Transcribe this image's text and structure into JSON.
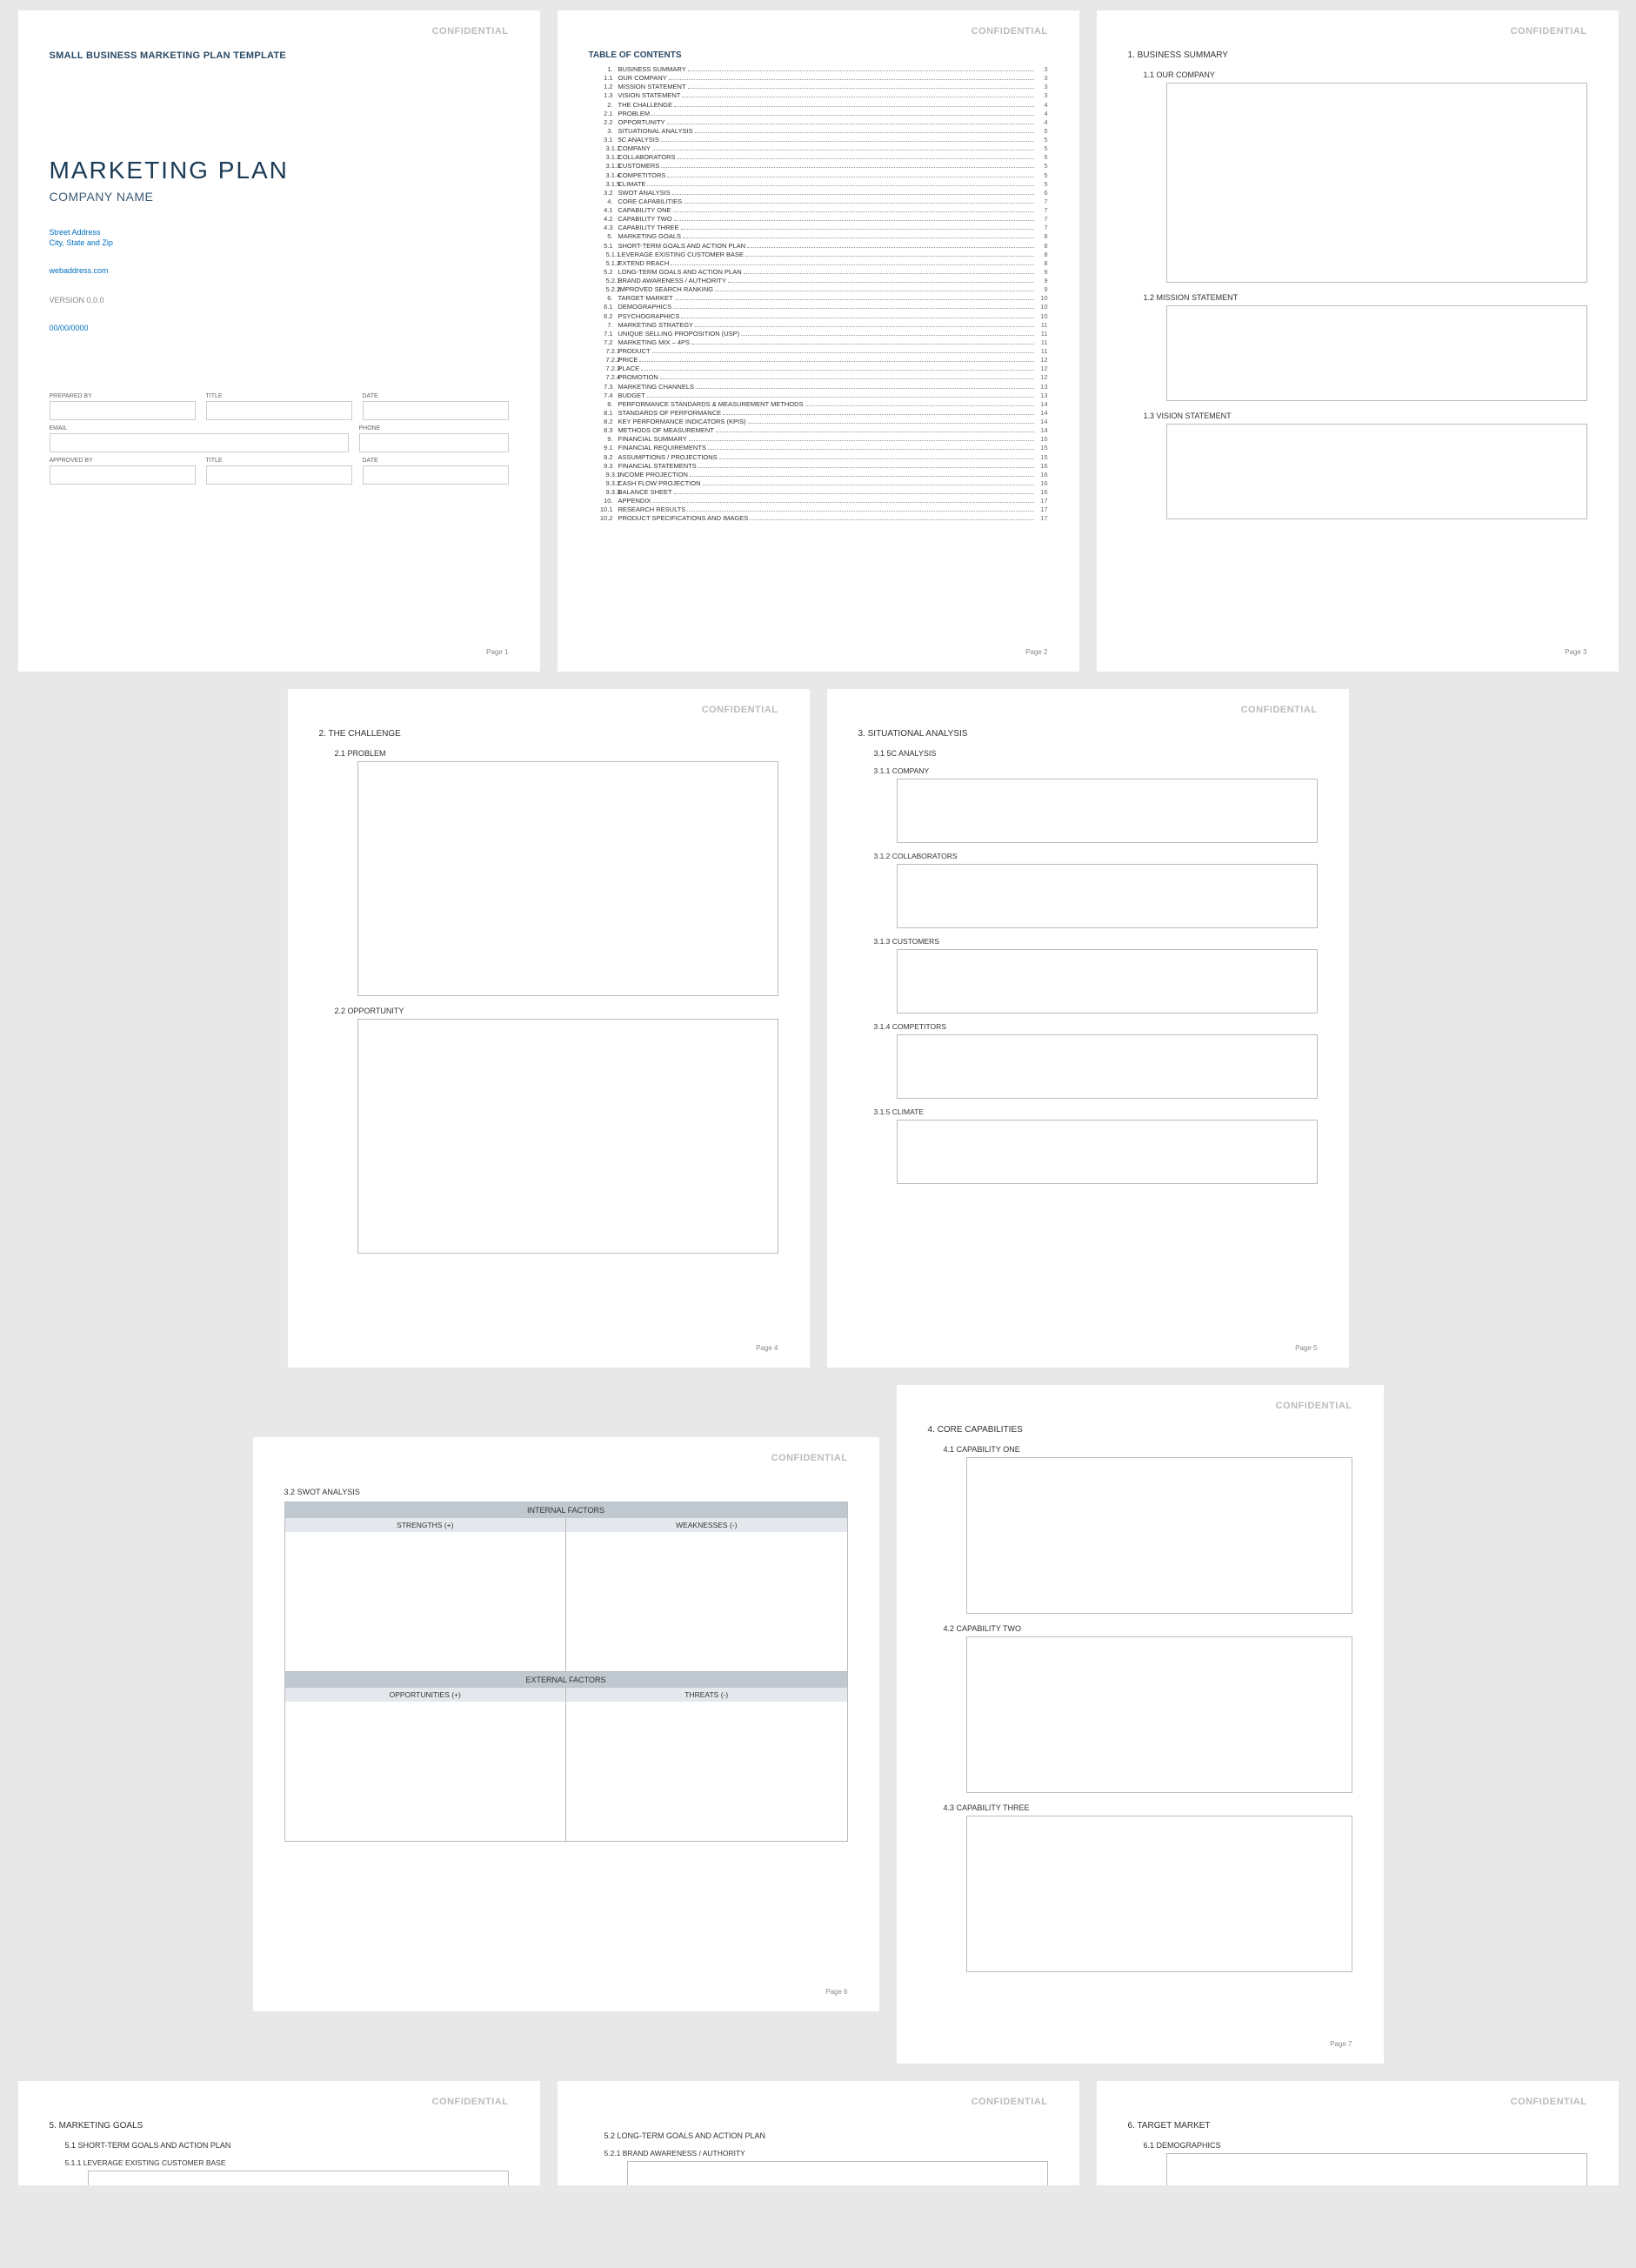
{
  "confidential": "CONFIDENTIAL",
  "p1": {
    "template": "SMALL BUSINESS MARKETING PLAN TEMPLATE",
    "title": "MARKETING PLAN",
    "company": "COMPANY NAME",
    "addr1": "Street Address",
    "addr2": "City, State and Zip",
    "web": "webaddress.com",
    "version": "VERSION 0.0.0",
    "date": "00/00/0000",
    "preparedby": "PREPARED BY",
    "titlelbl": "TITLE",
    "datelbl": "DATE",
    "email": "EMAIL",
    "phone": "PHONE",
    "approvedby": "APPROVED BY",
    "pagenum": "Page 1"
  },
  "p2": {
    "toc_title": "TABLE OF CONTENTS",
    "items": [
      {
        "l": 1,
        "n": "1.",
        "t": "BUSINESS SUMMARY",
        "p": "3"
      },
      {
        "l": 2,
        "n": "1.1",
        "t": "OUR COMPANY",
        "p": "3"
      },
      {
        "l": 2,
        "n": "1.2",
        "t": "MISSION STATEMENT",
        "p": "3"
      },
      {
        "l": 2,
        "n": "1.3",
        "t": "VISION STATEMENT",
        "p": "3"
      },
      {
        "l": 1,
        "n": "2.",
        "t": "THE CHALLENGE",
        "p": "4"
      },
      {
        "l": 2,
        "n": "2.1",
        "t": "PROBLEM",
        "p": "4"
      },
      {
        "l": 2,
        "n": "2.2",
        "t": "OPPORTUNITY",
        "p": "4"
      },
      {
        "l": 1,
        "n": "3.",
        "t": "SITUATIONAL ANALYSIS",
        "p": "5"
      },
      {
        "l": 2,
        "n": "3.1",
        "t": "5C ANALYSIS",
        "p": "5"
      },
      {
        "l": 3,
        "n": "3.1.1",
        "t": "COMPANY",
        "p": "5"
      },
      {
        "l": 3,
        "n": "3.1.2",
        "t": "COLLABORATORS",
        "p": "5"
      },
      {
        "l": 3,
        "n": "3.1.3",
        "t": "CUSTOMERS",
        "p": "5"
      },
      {
        "l": 3,
        "n": "3.1.4",
        "t": "COMPETITORS",
        "p": "5"
      },
      {
        "l": 3,
        "n": "3.1.5",
        "t": "CLIMATE",
        "p": "5"
      },
      {
        "l": 2,
        "n": "3.2",
        "t": "SWOT ANALYSIS",
        "p": "6"
      },
      {
        "l": 1,
        "n": "4.",
        "t": "CORE CAPABILITIES",
        "p": "7"
      },
      {
        "l": 2,
        "n": "4.1",
        "t": "CAPABILITY ONE",
        "p": "7"
      },
      {
        "l": 2,
        "n": "4.2",
        "t": "CAPABILITY TWO",
        "p": "7"
      },
      {
        "l": 2,
        "n": "4.3",
        "t": "CAPABILITY THREE",
        "p": "7"
      },
      {
        "l": 1,
        "n": "5.",
        "t": "MARKETING GOALS",
        "p": "8"
      },
      {
        "l": 2,
        "n": "5.1",
        "t": "SHORT-TERM GOALS AND ACTION PLAN",
        "p": "8"
      },
      {
        "l": 3,
        "n": "5.1.1",
        "t": "LEVERAGE EXISTING CUSTOMER BASE",
        "p": "8"
      },
      {
        "l": 3,
        "n": "5.1.2",
        "t": "EXTEND REACH",
        "p": "8"
      },
      {
        "l": 2,
        "n": "5.2",
        "t": "LONG-TERM GOALS AND ACTION PLAN",
        "p": "9"
      },
      {
        "l": 3,
        "n": "5.2.1",
        "t": "BRAND AWARENESS / AUTHORITY",
        "p": "9"
      },
      {
        "l": 3,
        "n": "5.2.2",
        "t": "IMPROVED SEARCH RANKING",
        "p": "9"
      },
      {
        "l": 1,
        "n": "6.",
        "t": "TARGET MARKET",
        "p": "10"
      },
      {
        "l": 2,
        "n": "6.1",
        "t": "DEMOGRAPHICS",
        "p": "10"
      },
      {
        "l": 2,
        "n": "6.2",
        "t": "PSYCHOGRAPHICS",
        "p": "10"
      },
      {
        "l": 1,
        "n": "7.",
        "t": "MARKETING STRATEGY",
        "p": "11"
      },
      {
        "l": 2,
        "n": "7.1",
        "t": "UNIQUE SELLING PROPOSITION (USP)",
        "p": "11"
      },
      {
        "l": 2,
        "n": "7.2",
        "t": "MARKETING MIX – 4Ps",
        "p": "11"
      },
      {
        "l": 3,
        "n": "7.2.1",
        "t": "PRODUCT",
        "p": "11"
      },
      {
        "l": 3,
        "n": "7.2.2",
        "t": "PRICE",
        "p": "12"
      },
      {
        "l": 3,
        "n": "7.2.3",
        "t": "PLACE",
        "p": "12"
      },
      {
        "l": 3,
        "n": "7.2.4",
        "t": "PROMOTION",
        "p": "12"
      },
      {
        "l": 2,
        "n": "7.3",
        "t": "MARKETING CHANNELS",
        "p": "13"
      },
      {
        "l": 2,
        "n": "7.4",
        "t": "BUDGET",
        "p": "13"
      },
      {
        "l": 1,
        "n": "8.",
        "t": "PERFORMANCE STANDARDS & MEASUREMENT METHODS",
        "p": "14"
      },
      {
        "l": 2,
        "n": "8.1",
        "t": "STANDARDS OF PERFORMANCE",
        "p": "14"
      },
      {
        "l": 2,
        "n": "8.2",
        "t": "KEY PERFORMANCE INDICATORS (KPIs)",
        "p": "14"
      },
      {
        "l": 2,
        "n": "8.3",
        "t": "METHODS OF MEASUREMENT",
        "p": "14"
      },
      {
        "l": 1,
        "n": "9.",
        "t": "FINANCIAL SUMMARY",
        "p": "15"
      },
      {
        "l": 2,
        "n": "9.1",
        "t": "FINANCIAL REQUIREMENTS",
        "p": "15"
      },
      {
        "l": 2,
        "n": "9.2",
        "t": "ASSUMPTIONS / PROJECTIONS",
        "p": "15"
      },
      {
        "l": 2,
        "n": "9.3",
        "t": "FINANCIAL STATEMENTS",
        "p": "16"
      },
      {
        "l": 3,
        "n": "9.3.1",
        "t": "INCOME PROJECTION",
        "p": "16"
      },
      {
        "l": 3,
        "n": "9.3.2",
        "t": "CASH FLOW PROJECTION",
        "p": "16"
      },
      {
        "l": 3,
        "n": "9.3.3",
        "t": "BALANCE SHEET",
        "p": "16"
      },
      {
        "l": 1,
        "n": "10.",
        "t": "APPENDIX",
        "p": "17"
      },
      {
        "l": 2,
        "n": "10.1",
        "t": "RESEARCH RESULTS",
        "p": "17"
      },
      {
        "l": 2,
        "n": "10.2",
        "t": "PRODUCT SPECIFICATIONS AND IMAGES",
        "p": "17"
      }
    ],
    "pagenum": "Page 2"
  },
  "p3": {
    "h1": "1. BUSINESS SUMMARY",
    "s1": "1.1   OUR COMPANY",
    "s2": "1.2   MISSION STATEMENT",
    "s3": "1.3   VISION STATEMENT",
    "pagenum": "Page 3"
  },
  "p4": {
    "h1": "2. THE CHALLENGE",
    "s1": "2.1   PROBLEM",
    "s2": "2.2   OPPORTUNITY",
    "pagenum": "Page 4"
  },
  "p5": {
    "h1": "3. SITUATIONAL ANALYSIS",
    "s1": "3.1   5C ANALYSIS",
    "a": "3.1.1   COMPANY",
    "b": "3.1.2   COLLABORATORS",
    "c": "3.1.3   CUSTOMERS",
    "d": "3.1.4   COMPETITORS",
    "e": "3.1.5   CLIMATE",
    "pagenum": "Page 5"
  },
  "p6": {
    "s1": "3.2   SWOT ANALYSIS",
    "internal": "INTERNAL FACTORS",
    "strengths": "STRENGTHS (+)",
    "weaknesses": "WEAKNESSES (-)",
    "external": "EXTERNAL FACTORS",
    "opportunities": "OPPORTUNITIES (+)",
    "threats": "THREATS (-)",
    "pagenum": "Page 6"
  },
  "p7": {
    "h1": "4. CORE CAPABILITIES",
    "s1": "4.1   CAPABILITY ONE",
    "s2": "4.2   CAPABILITY TWO",
    "s3": "4.3   CAPABILITY THREE",
    "pagenum": "Page 7"
  },
  "p8": {
    "h1": "5. MARKETING GOALS",
    "s1": "5.1   SHORT-TERM GOALS AND ACTION PLAN",
    "a": "5.1.1   LEVERAGE EXISTING CUSTOMER BASE"
  },
  "p9": {
    "s1": "5.2   LONG-TERM GOALS AND ACTION PLAN",
    "a": "5.2.1   BRAND AWARENESS / AUTHORITY"
  },
  "p10": {
    "h1": "6. TARGET MARKET",
    "s1": "6.1   DEMOGRAPHICS"
  }
}
